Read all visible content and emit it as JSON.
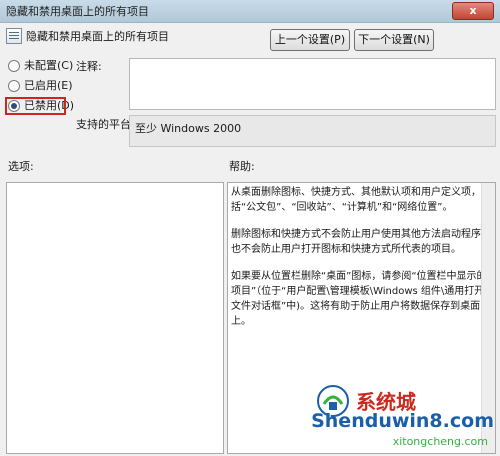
{
  "window": {
    "title": "隐藏和禁用桌面上的所有项目",
    "close_label": "x"
  },
  "header": {
    "policy_name": "隐藏和禁用桌面上的所有项目",
    "prev_button": "上一个设置(P)",
    "next_button": "下一个设置(N)"
  },
  "state_options": [
    {
      "label": "未配置(C)",
      "checked": false
    },
    {
      "label": "已启用(E)",
      "checked": false
    },
    {
      "label": "已禁用(D)",
      "checked": true
    }
  ],
  "comment": {
    "label": "注释:",
    "value": ""
  },
  "platform": {
    "label": "支持的平台:",
    "value": "至少 Windows 2000"
  },
  "options": {
    "label": "选项:"
  },
  "help": {
    "label": "帮助:",
    "paragraphs": [
      "从桌面删除图标、快捷方式、其他默认项和用户定义项，包括“公文包”、“回收站”、“计算机”和“网络位置”。",
      "删除图标和快捷方式不会防止用户使用其他方法启动程序，也不会防止用户打开图标和快捷方式所代表的项目。",
      "如果要从位置栏删除“桌面”图标，请参阅“位置栏中显示的项目”（位于“用户配置\\管理模板\\Windows 组件\\通用打开文件对话框”中)。这将有助于防止用户将数据保存到桌面上。"
    ]
  },
  "watermark": {
    "brand": "系统城",
    "site": "Shenduwin8.com",
    "sub": "xitongcheng.com"
  }
}
